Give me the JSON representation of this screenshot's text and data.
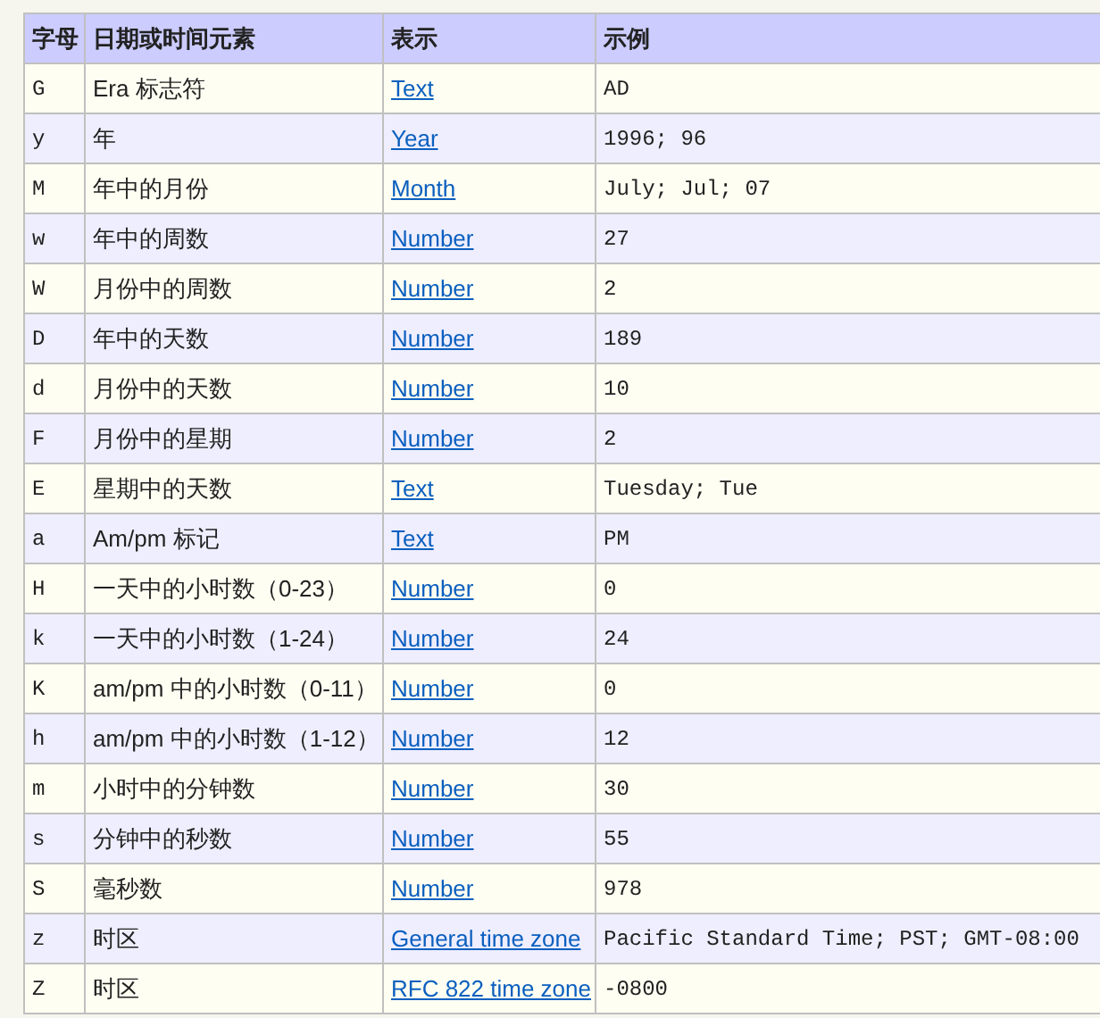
{
  "table": {
    "columns": [
      "字母",
      "日期或时间元素",
      "表示",
      "示例"
    ],
    "rows": [
      {
        "letter": "G",
        "element": "Era 标志符",
        "presentation": "Text",
        "example": "AD"
      },
      {
        "letter": "y",
        "element": "年",
        "presentation": "Year",
        "example": "1996; 96"
      },
      {
        "letter": "M",
        "element": "年中的月份",
        "presentation": "Month",
        "example": "July; Jul; 07"
      },
      {
        "letter": "w",
        "element": "年中的周数",
        "presentation": "Number",
        "example": "27"
      },
      {
        "letter": "W",
        "element": "月份中的周数",
        "presentation": "Number",
        "example": "2"
      },
      {
        "letter": "D",
        "element": "年中的天数",
        "presentation": "Number",
        "example": "189"
      },
      {
        "letter": "d",
        "element": "月份中的天数",
        "presentation": "Number",
        "example": "10"
      },
      {
        "letter": "F",
        "element": "月份中的星期",
        "presentation": "Number",
        "example": "2"
      },
      {
        "letter": "E",
        "element": "星期中的天数",
        "presentation": "Text",
        "example": "Tuesday; Tue"
      },
      {
        "letter": "a",
        "element": "Am/pm 标记",
        "presentation": "Text",
        "example": "PM"
      },
      {
        "letter": "H",
        "element": "一天中的小时数（0-23）",
        "presentation": "Number",
        "example": "0"
      },
      {
        "letter": "k",
        "element": "一天中的小时数（1-24）",
        "presentation": "Number",
        "example": "24"
      },
      {
        "letter": "K",
        "element": "am/pm 中的小时数（0-11）",
        "presentation": "Number",
        "example": "0"
      },
      {
        "letter": "h",
        "element": "am/pm 中的小时数（1-12）",
        "presentation": "Number",
        "example": "12"
      },
      {
        "letter": "m",
        "element": "小时中的分钟数",
        "presentation": "Number",
        "example": "30"
      },
      {
        "letter": "s",
        "element": "分钟中的秒数",
        "presentation": "Number",
        "example": "55"
      },
      {
        "letter": "S",
        "element": "毫秒数",
        "presentation": "Number",
        "example": "978"
      },
      {
        "letter": "z",
        "element": "时区",
        "presentation": "General time zone",
        "example": "Pacific Standard Time; PST; GMT-08:00"
      },
      {
        "letter": "Z",
        "element": "时区",
        "presentation": "RFC 822 time zone",
        "example": "-0800"
      }
    ]
  }
}
